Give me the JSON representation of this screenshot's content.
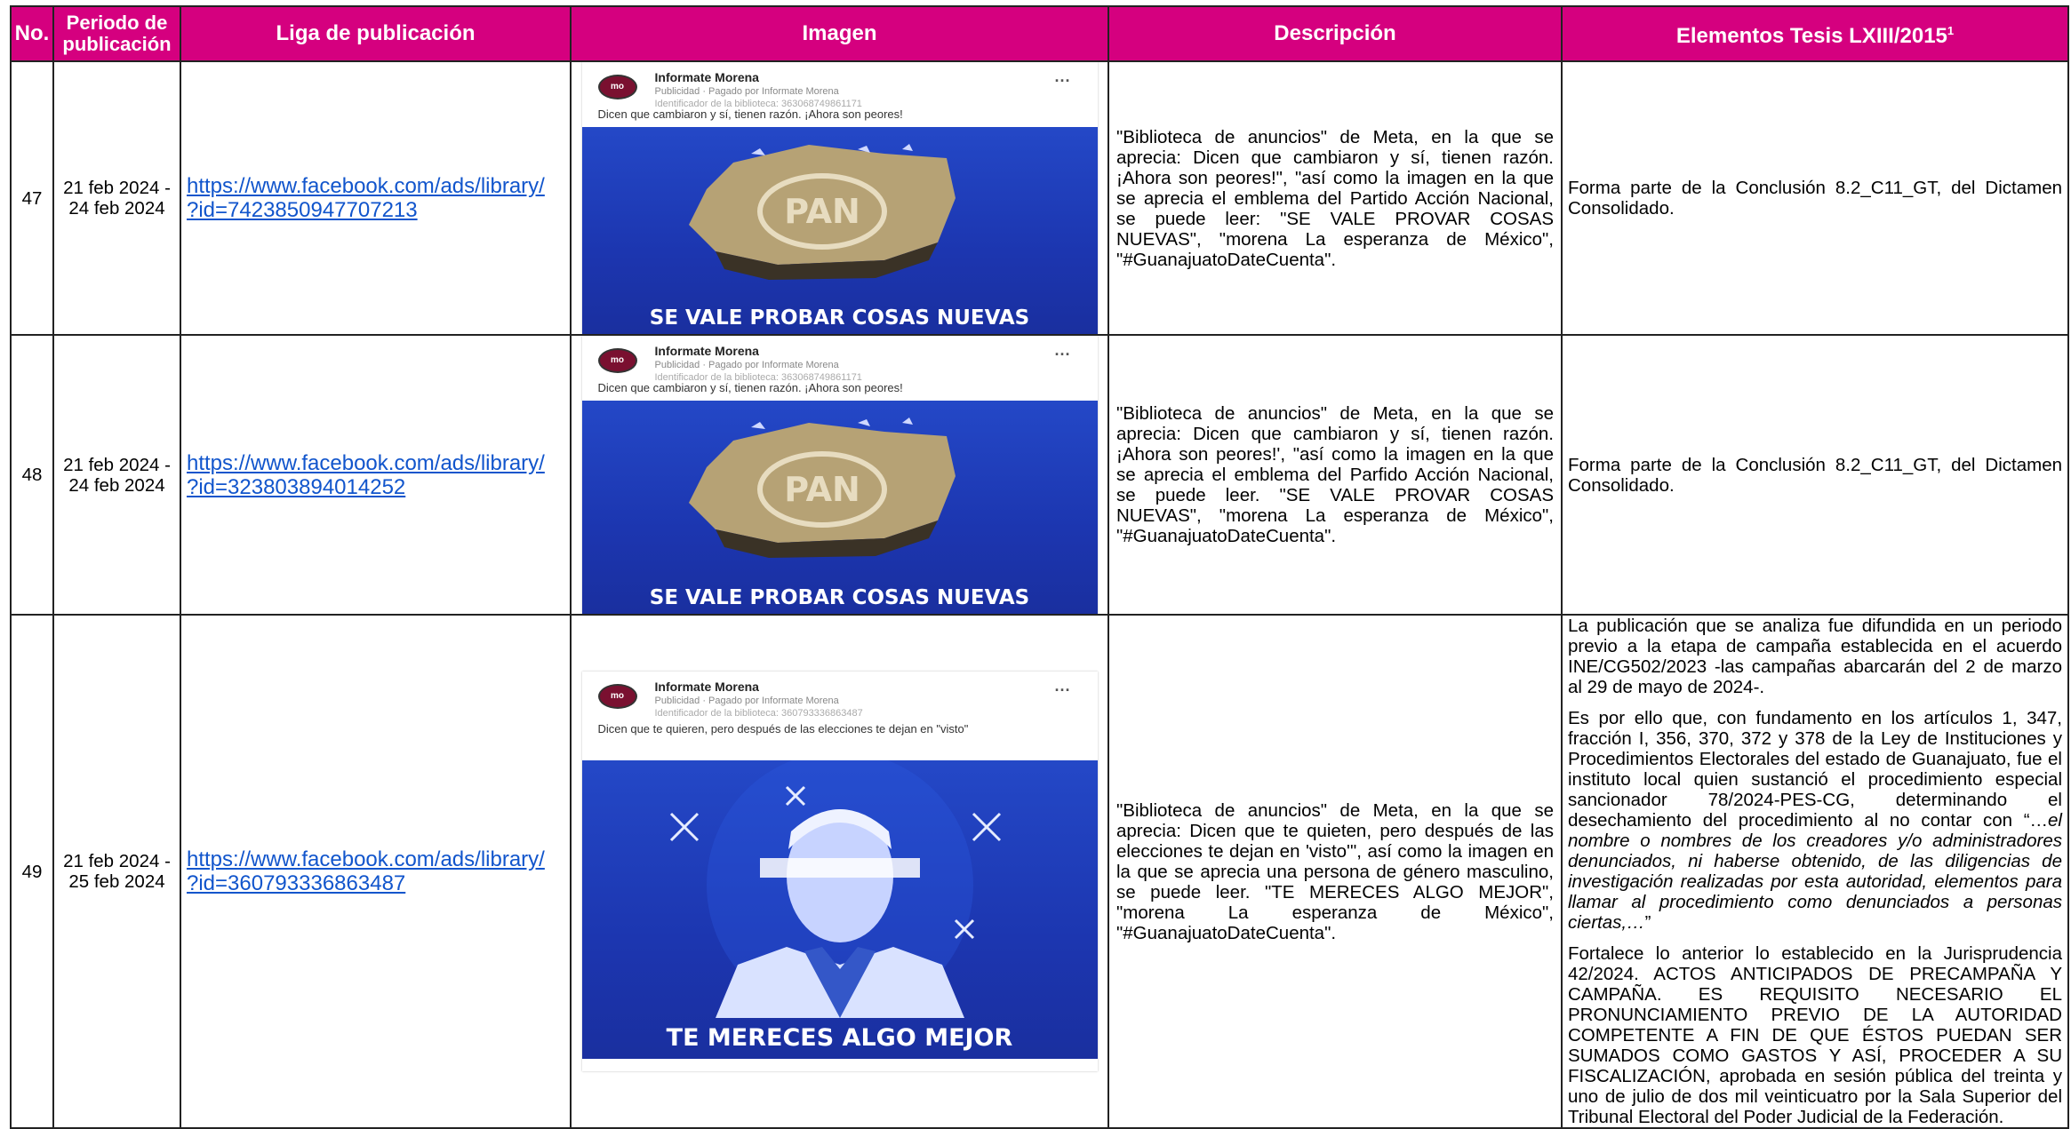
{
  "headers": {
    "no": "No.",
    "period": "Periodo de publicación",
    "link": "Liga de publicación",
    "image": "Imagen",
    "description": "Descripción",
    "elements": "Elementos Tesis LXIII/2015",
    "elements_sup": "1"
  },
  "rows": [
    {
      "no": "47",
      "period_start": "21 feb 2024 -",
      "period_end": "24 feb 2024",
      "link_line1": "https://www.facebook.com/ads/library/",
      "link_line2": "?id=7423850947707213",
      "ad": {
        "page_name": "Informate Morena",
        "sponsor": "Publicidad · Pagado por Informate Morena",
        "library_id": "Identificador de la biblioteca: 363068749861171",
        "caption": "Dicen que cambiaron y sí, tienen razón. ¡Ahora son peores!",
        "slogan": "SE VALE PROBAR COSAS NUEVAS",
        "emblem": "PAN"
      },
      "description": "\"Biblioteca de anuncios\" de Meta, en la que se aprecia: Dicen que cambiaron y sí, tienen razón. ¡Ahora son peores!\", \"así como la imagen en la que se aprecia el emblema del Partido Acción Nacional, se puede leer: \"SE VALE PROVAR COSAS NUEVAS\", \"morena La esperanza de México\", \"#GuanajuatoDateCuenta\".",
      "elements": "Forma parte de la Conclusión 8.2_C11_GT, del Dictamen Consolidado."
    },
    {
      "no": "48",
      "period_start": "21 feb 2024 -",
      "period_end": "24 feb 2024",
      "link_line1": "https://www.facebook.com/ads/library/",
      "link_line2": "?id=323803894014252",
      "ad": {
        "page_name": "Informate Morena",
        "sponsor": "Publicidad · Pagado por Informate Morena",
        "library_id": "Identificador de la biblioteca: 363068749861171",
        "caption": "Dicen que cambiaron y sí, tienen razón. ¡Ahora son peores!",
        "slogan": "SE VALE PROBAR COSAS NUEVAS",
        "emblem": "PAN"
      },
      "description": "\"Biblioteca de anuncios\" de Meta, en la que se aprecia: Dicen que cambiaron y sí, tienen razón. ¡Ahora son peores!', \"así como la imagen en la que se aprecia el emblema del Parfido Acción Nacional, se puede leer. \"SE VALE PROVAR COSAS NUEVAS\", \"morena La esperanza de México\", \"#GuanajuatoDateCuenta\".",
      "elements": "Forma parte de la Conclusión 8.2_C11_GT, del Dictamen Consolidado."
    },
    {
      "no": "49",
      "period_start": "21 feb 2024 -",
      "period_end": "25 feb 2024",
      "link_line1": "https://www.facebook.com/ads/library/",
      "link_line2": "?id=360793336863487",
      "ad": {
        "page_name": "Informate Morena",
        "sponsor": "Publicidad · Pagado por Informate Morena",
        "library_id": "Identificador de la biblioteca: 360793336863487",
        "caption": "Dicen que te quieren, pero después de las elecciones te dejan en \"visto\"",
        "slogan": "TE MERECES ALGO MEJOR"
      },
      "description": "\"Biblioteca de anuncios\" de Meta, en la que se aprecia: Dicen que te quieten, pero después de las elecciones te dejan en 'visto'\", así como la imagen en la que se aprecia una persona de género masculino, se puede leer. \"TE MERECES ALGO MEJOR\", \"morena La esperanza de México\", \"#GuanajuatoDateCuenta\".",
      "elements_p1": "La publicación que se analiza fue difundida en un periodo previo a la etapa de campaña establecida en el acuerdo INE/CG502/2023 -las campañas abarcarán del 2 de marzo al 29 de mayo de 2024-.",
      "elements_p2_a": "Es por ello que, con fundamento en los artículos 1, 347, fracción I, 356, 370, 372 y 378 de la Ley de Instituciones y Procedimientos Electorales del estado de Guanajuato, fue el instituto local quien sustanció el procedimiento especial sancionador 78/2024-PES-CG, determinando el desechamiento del procedimiento al no contar con “…",
      "elements_p2_italic": "el nombre o nombres de los creadores y/o administradores denunciados, ni haberse obtenido, de las diligencias de investigación realizadas por esta autoridad, elementos para llamar al procedimiento como denunciados a personas ciertas,…",
      "elements_p2_b": "”",
      "elements_p3": "Fortalece lo anterior lo establecido en la Jurisprudencia 42/2024. ACTOS ANTICIPADOS DE PRECAMPAÑA Y CAMPAÑA. ES REQUISITO NECESARIO EL PRONUNCIAMIENTO PREVIO DE LA AUTORIDAD COMPETENTE A FIN DE QUE ÉSTOS PUEDAN SER SUMADOS COMO GASTOS Y ASÍ, PROCEDER A SU FISCALIZACIÓN, aprobada en sesión pública del treinta y uno de julio de dos mil veinticuatro por la Sala Superior del Tribunal Electoral del Poder Judicial de la Federación."
    }
  ],
  "colors": {
    "header_bg": "#d5007f",
    "link": "#1155cc",
    "ad_blue": "#2448c7"
  },
  "icons": {
    "page_logo": "morena-logo-icon",
    "more": "more-options-icon"
  }
}
